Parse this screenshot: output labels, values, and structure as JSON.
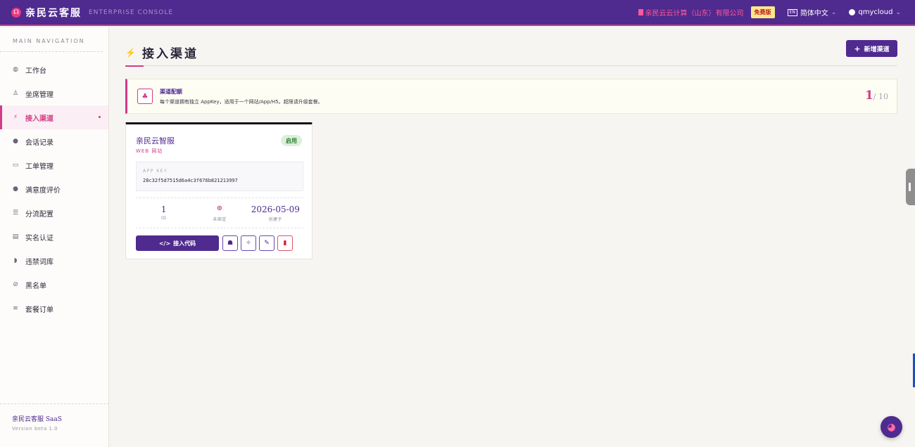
{
  "topbar": {
    "brand_name": "亲民云客服",
    "brand_sub": "ENTERPRISE CONSOLE",
    "company": "亲民云云计算（山东）有限公司",
    "plan_badge": "免费版",
    "language": "简体中文",
    "language_icon_text": "EN",
    "username": "qmycloud"
  },
  "sidebar": {
    "heading": "MAIN NAVIGATION",
    "items": [
      {
        "label": "工作台",
        "icon": "dashboard-icon"
      },
      {
        "label": "坐席管理",
        "icon": "agents-icon"
      },
      {
        "label": "接入渠道",
        "icon": "plug-icon"
      },
      {
        "label": "会话记录",
        "icon": "chat-icon"
      },
      {
        "label": "工单管理",
        "icon": "ticket-icon"
      },
      {
        "label": "满意度评价",
        "icon": "rating-icon"
      },
      {
        "label": "分流配置",
        "icon": "routing-icon"
      },
      {
        "label": "实名认证",
        "icon": "id-card-icon"
      },
      {
        "label": "违禁词库",
        "icon": "shield-icon"
      },
      {
        "label": "黑名单",
        "icon": "ban-icon"
      },
      {
        "label": "套餐订单",
        "icon": "layers-icon"
      }
    ],
    "active_index": 2,
    "footer_title": "亲民云客服 SaaS",
    "footer_version": "Version beta 1.0"
  },
  "page": {
    "title": "接入渠道",
    "add_button": "新增渠道"
  },
  "quota": {
    "title": "渠道配额",
    "description": "每个渠道拥有独立 AppKey，适用于一个网站/App/H5。超限请升级套餐。",
    "used": "1",
    "total": "/ 10"
  },
  "channels": [
    {
      "name": "亲民云智服",
      "type": "WEB 网站",
      "status": "启用",
      "app_key_label": "APP KEY",
      "app_key": "28c32f5d7515d6a4c3f676b821213997",
      "id_value": "1",
      "id_label": "ID",
      "domain_label": "未绑定",
      "created_value": "2026-05-09",
      "created_label": "创建于",
      "code_button": "接入代码"
    }
  ],
  "colors": {
    "primary": "#4f2a8f",
    "accent": "#d23b86",
    "background": "#f6f5f2"
  }
}
